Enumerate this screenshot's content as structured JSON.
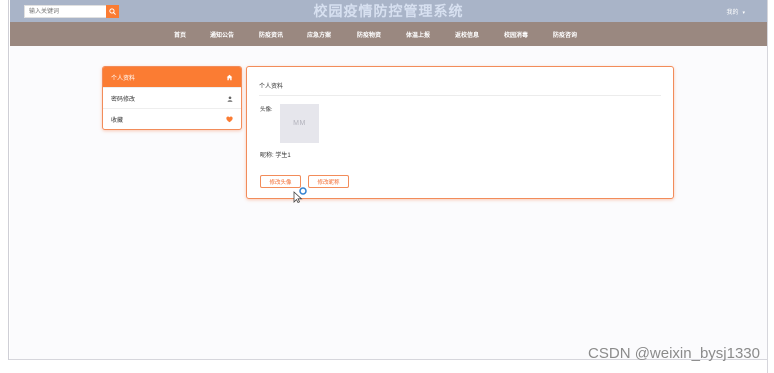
{
  "header": {
    "search_placeholder": "输入关键词",
    "site_title": "校园疫情防控管理系统",
    "user_menu": "我的"
  },
  "nav": {
    "items": [
      "首页",
      "通知公告",
      "防疫资讯",
      "应急方案",
      "防疫物资",
      "体温上报",
      "返校信息",
      "校园消毒",
      "防疫咨询"
    ]
  },
  "sidebar": {
    "items": [
      {
        "label": "个人资料",
        "icon": "home-icon"
      },
      {
        "label": "密码修改",
        "icon": "user-icon"
      },
      {
        "label": "收藏",
        "icon": "heart-icon"
      }
    ]
  },
  "profile": {
    "section_title": "个人资料",
    "avatar_label": "头像:",
    "avatar_placeholder": "MM",
    "nickname_label": "昵称:",
    "nickname_value": "学生1",
    "change_avatar_button": "修改头像",
    "change_nickname_button": "修改昵称"
  },
  "watermark": "CSDN @weixin_bysj1330",
  "colors": {
    "accent": "#fb7c33",
    "topbar": "#a9b4c8",
    "navbar": "#9a8880",
    "title_text": "#d7e0f0"
  }
}
